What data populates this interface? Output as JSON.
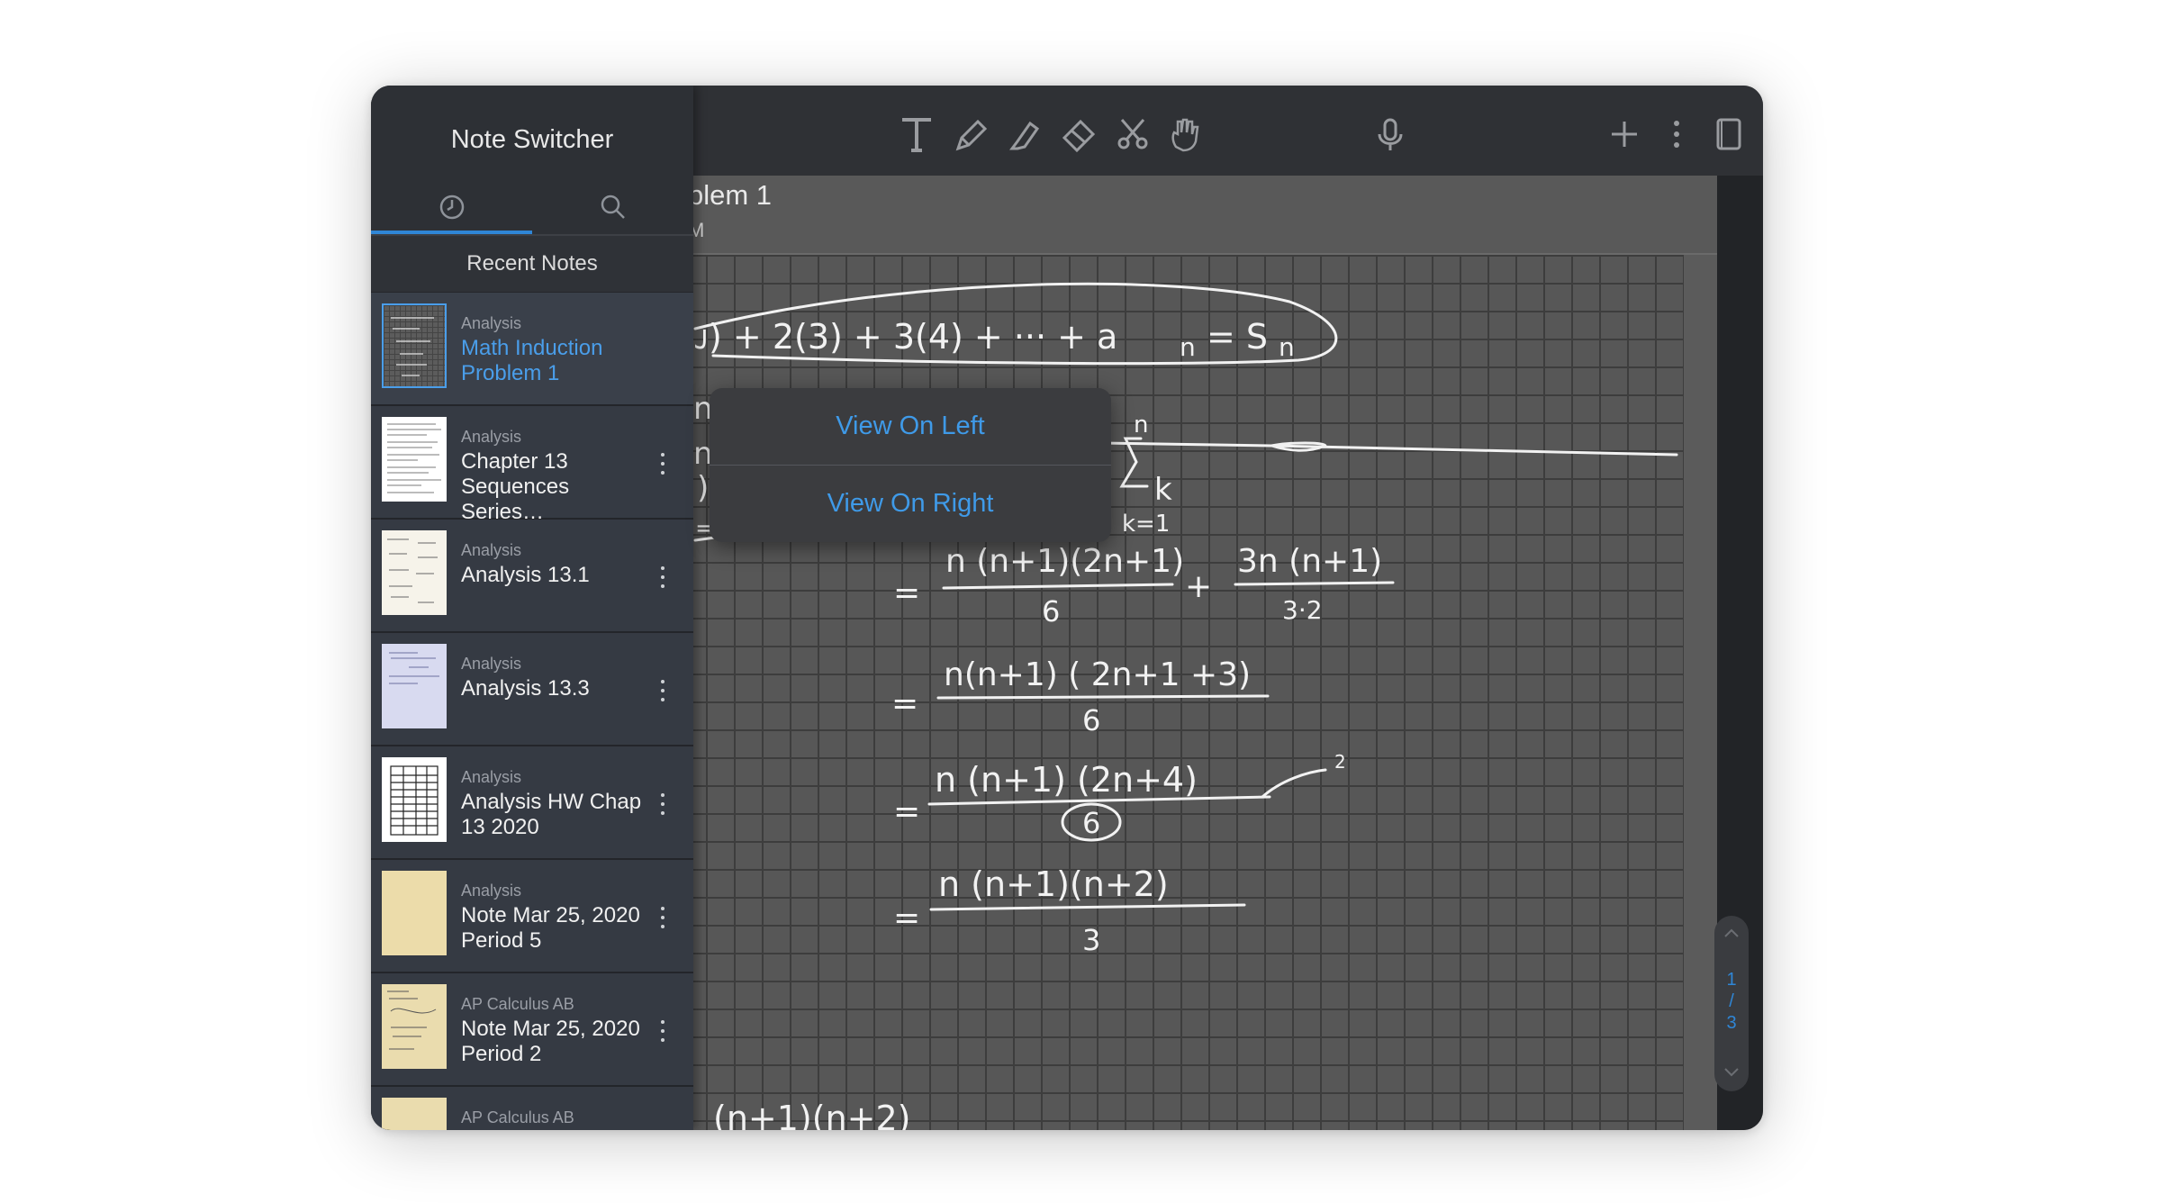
{
  "sidebar": {
    "title": "Note Switcher",
    "tabs": [
      {
        "icon": "clock-icon",
        "active": true
      },
      {
        "icon": "search-icon",
        "active": false
      }
    ],
    "section_label": "Recent Notes",
    "notes": [
      {
        "category": "Analysis",
        "title": "Math Induction\nProblem 1",
        "active": true
      },
      {
        "category": "Analysis",
        "title": "Chapter 13\nSequences Series…",
        "active": false
      },
      {
        "category": "Analysis",
        "title": "Analysis 13.1",
        "active": false
      },
      {
        "category": "Analysis",
        "title": "Analysis 13.3",
        "active": false
      },
      {
        "category": "Analysis",
        "title": "Analysis HW Chap\n13 2020",
        "active": false
      },
      {
        "category": "Analysis",
        "title": "Note Mar 25, 2020\nPeriod 5",
        "active": false
      },
      {
        "category": "AP Calculus AB",
        "title": "Note Mar 25, 2020\nPeriod 2",
        "active": false
      },
      {
        "category": "AP Calculus AB",
        "title": "",
        "active": false
      }
    ]
  },
  "note": {
    "title_partial": "blem 1",
    "date_partial": "M"
  },
  "popup": {
    "view_left": "View On Left",
    "view_right": "View On Right"
  },
  "toolbar": {
    "icons": [
      "text-tool-icon",
      "pen-icon",
      "highlighter-icon",
      "eraser-icon",
      "lasso-scissors-icon",
      "hand-icon",
      "microphone-icon",
      "add-icon",
      "more-icon",
      "page-view-icon"
    ]
  },
  "page_indicator": {
    "current": "1",
    "separator": "/",
    "total": "3"
  },
  "colors": {
    "accent": "#2f86d6",
    "sidebar_bg": "#2d3035",
    "page_bg": "#5b5b5b"
  }
}
